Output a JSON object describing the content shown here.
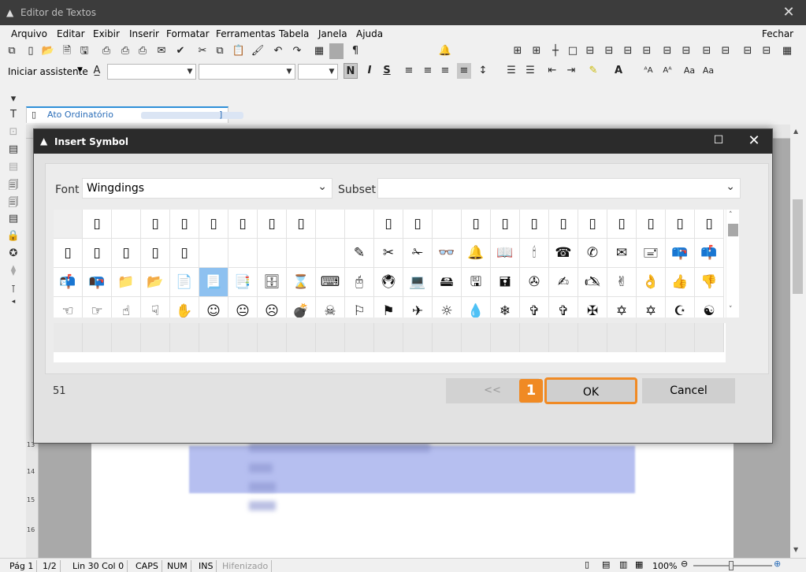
{
  "app": {
    "title": "Editor de Textos"
  },
  "menu": {
    "items": [
      "Arquivo",
      "Editar",
      "Exibir",
      "Inserir",
      "Formatar",
      "Ferramentas",
      "Tabela",
      "Janela",
      "Ajuda"
    ],
    "close_label": "Fechar"
  },
  "toolbar2": {
    "assistant_label": "Iniciar assistente",
    "bold": "N",
    "italic": "I",
    "underline": "S"
  },
  "document": {
    "tab_label": "Ato Ordinatório"
  },
  "dialog": {
    "title": "Insert Symbol",
    "font_label": "Font",
    "font_value": "Wingdings",
    "subset_label": "Subset",
    "subset_value": "",
    "count": "51",
    "prev_label": "<<",
    "ok_label": "OK",
    "cancel_label": "Cancel",
    "callout": "1",
    "symbols": [
      [
        "",
        "▯",
        "",
        "▯",
        "▯",
        "▯",
        "▯",
        "▯",
        "▯",
        "",
        "",
        "▯",
        "▯",
        "",
        "▯",
        "▯",
        "▯",
        "▯",
        "▯",
        "▯",
        "▯",
        "▯",
        "▯"
      ],
      [
        "▯",
        "▯",
        "▯",
        "▯",
        "▯",
        "",
        "",
        "",
        "",
        "",
        "✎",
        "✂",
        "✁",
        "👓",
        "🔔",
        "📖",
        "🕯",
        "☎",
        "✆",
        "✉",
        "🖃",
        "📪",
        "📫"
      ],
      [
        "📬",
        "📭",
        "📁",
        "📂",
        "📄",
        "📃",
        "📑",
        "🗄",
        "⌛",
        "⌨",
        "🖰",
        "🖲",
        "💻",
        "🖴",
        "🖫",
        "🖬",
        "✇",
        "✍",
        "🖎",
        "✌",
        "👌",
        "👍",
        "👎"
      ],
      [
        "☜",
        "☞",
        "☝",
        "☟",
        "✋",
        "☺",
        "😐",
        "☹",
        "💣",
        "☠",
        "⚐",
        "⚑",
        "✈",
        "☼",
        "💧",
        "❄",
        "✞",
        "✞",
        "✠",
        "✡",
        "✡",
        "☪",
        "☯"
      ]
    ]
  },
  "statusbar": {
    "page": "Pág 1",
    "pages": "1/2",
    "position": "Lin 30  Col 0",
    "caps": "CAPS",
    "num": "NUM",
    "ins": "INS",
    "hyphen": "Hifenizado",
    "zoom": "100%"
  },
  "colors": {
    "accent": "#f08a24",
    "selection": "#8ec1f0",
    "titlebar": "#2b2b2b"
  }
}
